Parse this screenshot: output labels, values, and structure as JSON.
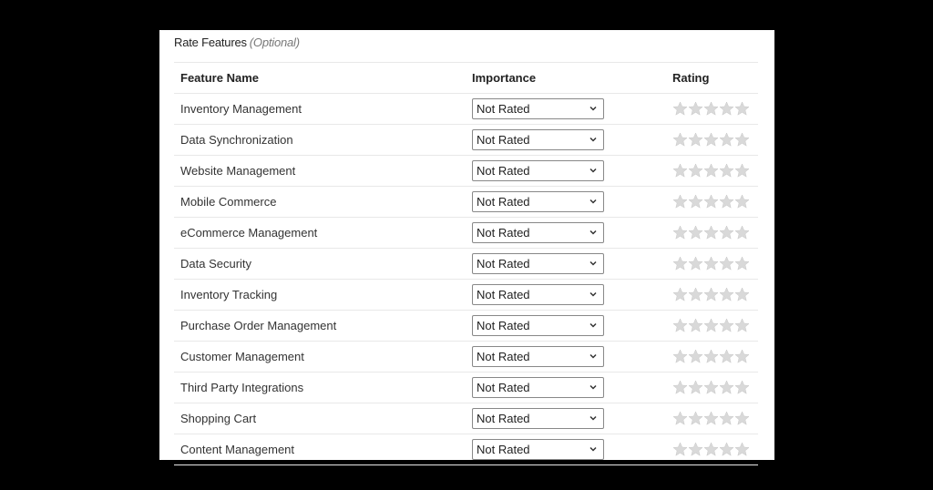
{
  "section": {
    "title": "Rate Features",
    "optional_label": "(Optional)"
  },
  "table": {
    "headers": {
      "feature_name": "Feature Name",
      "importance": "Importance",
      "rating": "Rating"
    },
    "rows": [
      {
        "feature": "Inventory Management",
        "importance": "Not Rated",
        "rating": 0,
        "max_rating": 5
      },
      {
        "feature": "Data Synchronization",
        "importance": "Not Rated",
        "rating": 0,
        "max_rating": 5
      },
      {
        "feature": "Website Management",
        "importance": "Not Rated",
        "rating": 0,
        "max_rating": 5
      },
      {
        "feature": "Mobile Commerce",
        "importance": "Not Rated",
        "rating": 0,
        "max_rating": 5
      },
      {
        "feature": "eCommerce Management",
        "importance": "Not Rated",
        "rating": 0,
        "max_rating": 5
      },
      {
        "feature": "Data Security",
        "importance": "Not Rated",
        "rating": 0,
        "max_rating": 5
      },
      {
        "feature": "Inventory Tracking",
        "importance": "Not Rated",
        "rating": 0,
        "max_rating": 5
      },
      {
        "feature": "Purchase Order Management",
        "importance": "Not Rated",
        "rating": 0,
        "max_rating": 5
      },
      {
        "feature": "Customer Management",
        "importance": "Not Rated",
        "rating": 0,
        "max_rating": 5
      },
      {
        "feature": "Third Party Integrations",
        "importance": "Not Rated",
        "rating": 0,
        "max_rating": 5
      },
      {
        "feature": "Shopping Cart",
        "importance": "Not Rated",
        "rating": 0,
        "max_rating": 5
      },
      {
        "feature": "Content Management",
        "importance": "Not Rated",
        "rating": 0,
        "max_rating": 5
      }
    ]
  },
  "colors": {
    "star_empty": "#d9d9d9",
    "star_filled": "#f5b400",
    "background": "#000000",
    "panel": "#ffffff"
  }
}
